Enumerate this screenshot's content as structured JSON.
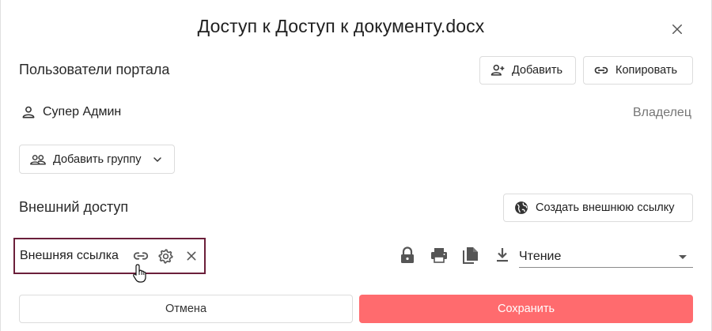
{
  "dialog": {
    "title": "Доступ к Доступ к документу.docx",
    "close_icon": "close-icon"
  },
  "portal_users": {
    "label": "Пользователи портала",
    "add_button": "Добавить",
    "copy_button": "Копировать",
    "users": [
      {
        "name": "Супер Админ",
        "role": "Владелец",
        "icon": "person-icon"
      }
    ],
    "add_group_button": "Добавить группу"
  },
  "external_access": {
    "label": "Внешний доступ",
    "create_link_button": "Создать внешнюю ссылку",
    "link": {
      "label": "Внешняя ссылка",
      "permission_icons": [
        "lock-icon",
        "print-icon",
        "copy-file-icon",
        "download-icon"
      ],
      "access_level": "Чтение"
    }
  },
  "footer": {
    "cancel": "Отмена",
    "save": "Сохранить"
  },
  "colors": {
    "accent": "#ff6b6e",
    "focus_border": "#6b1f3a",
    "owner_text": "#757575"
  }
}
